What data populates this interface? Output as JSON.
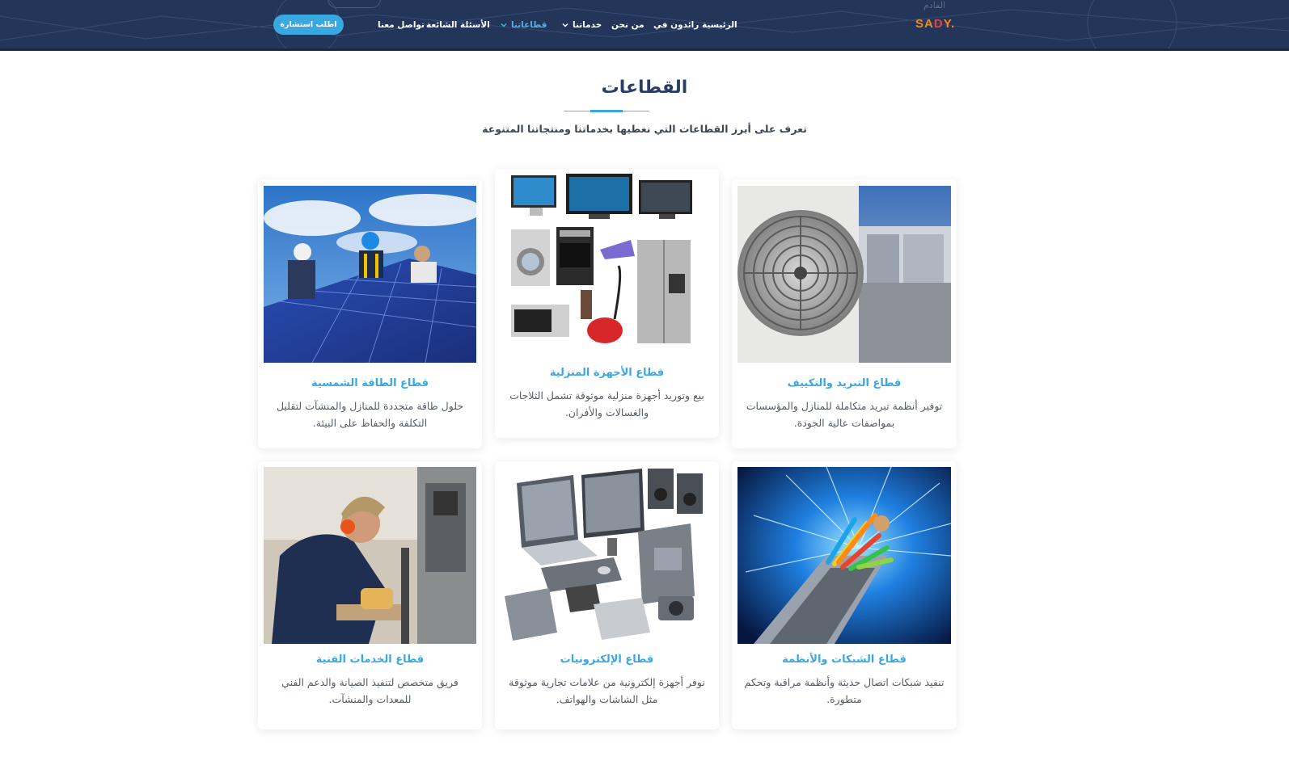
{
  "header": {
    "logo_main": "SA",
    "logo_accent": "D",
    "logo_end": "Y.",
    "faded_text": "القادم",
    "nav": {
      "home": "الرئيسية",
      "pioneers": "رائدون في",
      "about": "من نحن",
      "services": "خدماتنا",
      "sectors": "قطاعاتنا",
      "faq": "الأسئلة الشائعة",
      "contact": "تواصل معنا"
    },
    "cta_label": "اطلب استشارة"
  },
  "section": {
    "title": "القطاعات",
    "subtitle": "تعرف على أبرز القطاعات التي نغطيها بخدماتنا ومنتجاتنا المتنوعة"
  },
  "cards": [
    {
      "title": "قطاع التبريد والتكييف",
      "desc": "توفير أنظمة تبريد متكاملة للمنازل والمؤسسات بمواصفات عالية الجودة.",
      "image": "air-conditioner"
    },
    {
      "title": "قطاع الأجهزة المنزلية",
      "desc": "بيع وتوريد أجهزة منزلية موثوقة تشمل الثلاجات والغسالات والأفران.",
      "image": "home-appliances"
    },
    {
      "title": "قطاع الطاقة الشمسية",
      "desc": "حلول طاقة متجددة للمنازل والمنشآت لتقليل التكلفة والحفاظ على البيئة.",
      "image": "solar-panels"
    },
    {
      "title": "قطاع الشبكات والأنظمة",
      "desc": "تنفيذ شبكات اتصال حديثة وأنظمة مراقبة وتحكم متطورة.",
      "image": "fiber-cable"
    },
    {
      "title": "قطاع الإلكترونيات",
      "desc": "نوفر أجهزة إلكترونية من علامات تجارية موثوقة مثل الشاشات والهواتف.",
      "image": "electronics"
    },
    {
      "title": "قطاع الخدمات الفنية",
      "desc": "فريق متخصص لتنفيذ الصيانة والدعم الفني للمعدات والمنشآت.",
      "image": "technician"
    }
  ],
  "colors": {
    "header_bg": "#24355a",
    "accent": "#3aa8e0",
    "logo_orange": "#f28a1c",
    "title": "#2b3f66"
  }
}
